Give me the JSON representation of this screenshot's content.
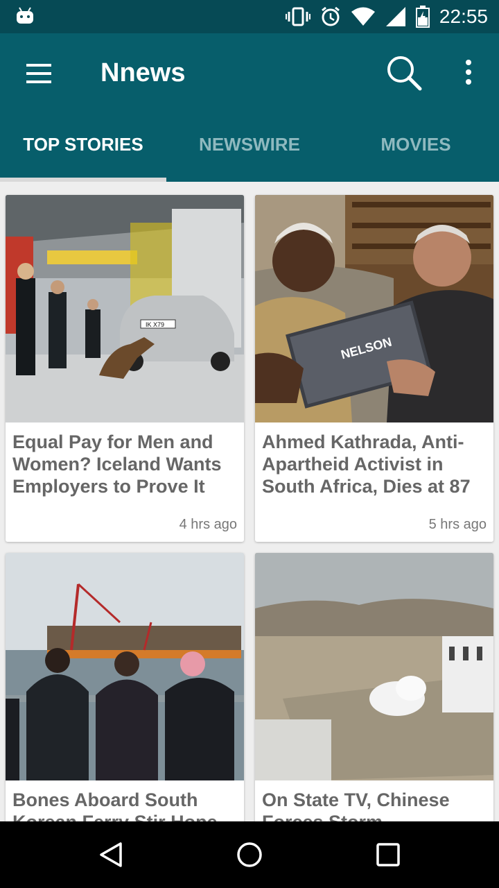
{
  "status_bar": {
    "time": "22:55",
    "icons": [
      "android-icon",
      "vibrate-icon",
      "alarm-icon",
      "wifi-icon",
      "signal-icon",
      "battery-icon"
    ]
  },
  "app_bar": {
    "title": "Nnews",
    "menu_icon": "menu-icon",
    "search_icon": "search-icon",
    "more_icon": "more-vert-icon"
  },
  "tabs": [
    {
      "label": "TOP STORIES",
      "active": true
    },
    {
      "label": "NEWSWIRE",
      "active": false
    },
    {
      "label": "MOVIES",
      "active": false
    }
  ],
  "stories": [
    {
      "title": "Equal Pay for Men and Women? Iceland Wants Employers to Prove It",
      "time": "4 hrs ago"
    },
    {
      "title": "Ahmed Kathrada, Anti-Apartheid Activist in South Africa, Dies at 87",
      "time": "5 hrs ago"
    },
    {
      "title": "Bones Aboard South Korean Ferry Stir Hope",
      "time": ""
    },
    {
      "title": "On State TV, Chinese Forces Storm",
      "time": ""
    }
  ],
  "images": {
    "story1": "police dog inspecting car in garage",
    "story1_plate": "IK X79",
    "story2_book": "NELSON"
  },
  "nav_bar": {
    "icons": [
      "back-icon",
      "home-icon",
      "recents-icon"
    ]
  },
  "colors": {
    "status_bar": "#064a55",
    "app_bar": "#075e6b",
    "inactive_tab": "#8fb9bf"
  }
}
